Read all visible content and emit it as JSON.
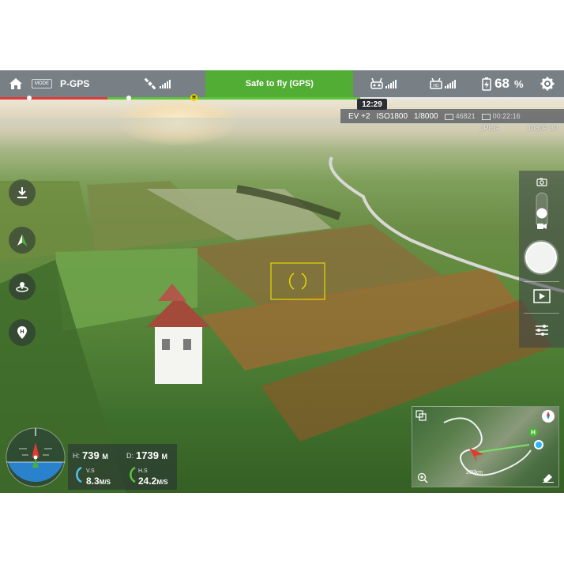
{
  "topbar": {
    "mode_label": "MODE",
    "flight_mode": "P-GPS",
    "status_text": "Safe to fly (GPS)",
    "status_color": "#52ad35",
    "battery_percent": "68",
    "battery_unit": "%",
    "battery_level": 0.68,
    "flight_time": "12:29",
    "icons": [
      "home-icon",
      "satellite-icon",
      "remote-controller-icon",
      "hd-signal-icon",
      "battery-icon",
      "gear-icon"
    ]
  },
  "camera": {
    "ev": "EV +2",
    "iso": "ISO1800",
    "shutter": "1/8000",
    "photos_remaining": "46821",
    "video_time": "00:22:16",
    "photo_format": "JPEG",
    "video_format": "1080P 30"
  },
  "left_toolbar": {
    "items": [
      "auto-takeoff-icon",
      "intelligent-flight-icon",
      "orbit-icon",
      "return-home-icon"
    ]
  },
  "telemetry": {
    "h_label": "H:",
    "h_value": "739",
    "h_unit": "M",
    "d_label": "D:",
    "d_value": "1739",
    "d_unit": "M",
    "vs_label": "V.S",
    "vs_value": "8.3",
    "vs_unit": "M/S",
    "hs_label": "H.S",
    "hs_value": "24.2",
    "hs_unit": "M/S"
  },
  "minimap": {
    "home_label": "H",
    "scale_text": "200km"
  },
  "colors": {
    "accent_green": "#52ad35",
    "battery_red": "#e03a3a",
    "focus_yellow": "#e6d800"
  }
}
